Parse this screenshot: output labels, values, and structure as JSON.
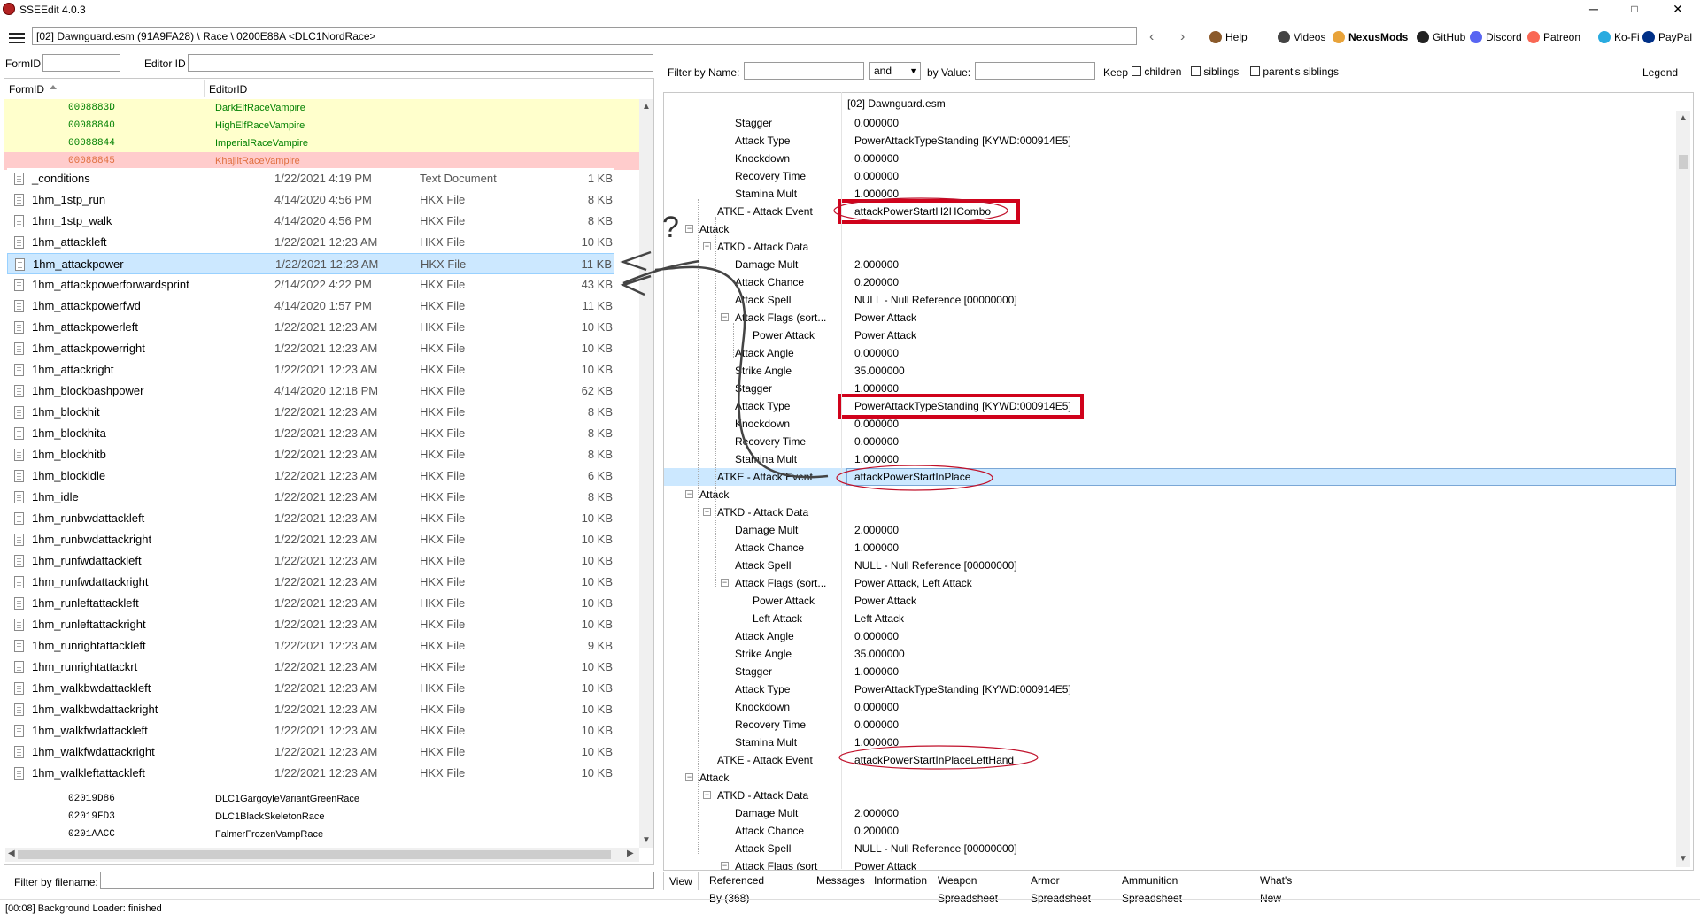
{
  "window": {
    "title": "SSEEdit 4.0.3",
    "minimize": "─",
    "maximize": "□",
    "close": "✕"
  },
  "toolbar": {
    "path": "[02] Dawnguard.esm (91A9FA28) \\ Race \\ 0200E88A <DLC1NordRace>",
    "back": "‹",
    "forward": "›",
    "links": [
      {
        "label": "Help",
        "icon": "book-icon",
        "color": "#8b5a2b"
      },
      {
        "label": "Videos",
        "icon": "video-icon",
        "color": "#444444"
      },
      {
        "label": "NexusMods",
        "icon": "nexusmods-icon",
        "color": "#e8a33a"
      },
      {
        "label": "GitHub",
        "icon": "github-icon",
        "color": "#222222"
      },
      {
        "label": "Discord",
        "icon": "discord-icon",
        "color": "#5865f2"
      },
      {
        "label": "Patreon",
        "icon": "patreon-icon",
        "color": "#f96854"
      },
      {
        "label": "Ko-Fi",
        "icon": "kofi-icon",
        "color": "#29abe0"
      },
      {
        "label": "PayPal",
        "icon": "paypal-icon",
        "color": "#003087"
      }
    ]
  },
  "left_filter": {
    "formid_label": "FormID",
    "editorid_label": "Editor ID"
  },
  "left_tree": {
    "col_formid": "FormID",
    "col_editorid": "EditorID",
    "top_rows": [
      {
        "fid": "0008883D",
        "eid": "DarkElfRaceVampire",
        "bg": "#ffffcc",
        "color": "#008000"
      },
      {
        "fid": "00088840",
        "eid": "HighElfRaceVampire",
        "bg": "#ffffcc",
        "color": "#008000"
      },
      {
        "fid": "00088844",
        "eid": "ImperialRaceVampire",
        "bg": "#ffffcc",
        "color": "#008000"
      },
      {
        "fid": "00088845",
        "eid": "KhajiitRaceVampire",
        "bg": "#ffcccc",
        "color": "#e07040"
      }
    ],
    "bottom_rows": [
      {
        "fid": "02019D86",
        "eid": "DLC1GargoyleVariantGreenRace"
      },
      {
        "fid": "02019FD3",
        "eid": "DLC1BlackSkeletonRace"
      },
      {
        "fid": "0201AACC",
        "eid": "FalmerFrozenVampRace"
      }
    ],
    "filter_label": "Filter by filename:"
  },
  "explorer": {
    "files": [
      {
        "name": "_conditions",
        "date": "1/22/2021 4:19 PM",
        "type": "Text Document",
        "size": "1 KB"
      },
      {
        "name": "1hm_1stp_run",
        "date": "4/14/2020 4:56 PM",
        "type": "HKX File",
        "size": "8 KB"
      },
      {
        "name": "1hm_1stp_walk",
        "date": "4/14/2020 4:56 PM",
        "type": "HKX File",
        "size": "8 KB"
      },
      {
        "name": "1hm_attackleft",
        "date": "1/22/2021 12:23 AM",
        "type": "HKX File",
        "size": "10 KB"
      },
      {
        "name": "1hm_attackpower",
        "date": "1/22/2021 12:23 AM",
        "type": "HKX File",
        "size": "11 KB"
      },
      {
        "name": "1hm_attackpowerforwardsprint",
        "date": "2/14/2022 4:22 PM",
        "type": "HKX File",
        "size": "43 KB"
      },
      {
        "name": "1hm_attackpowerfwd",
        "date": "4/14/2020 1:57 PM",
        "type": "HKX File",
        "size": "11 KB"
      },
      {
        "name": "1hm_attackpowerleft",
        "date": "1/22/2021 12:23 AM",
        "type": "HKX File",
        "size": "10 KB"
      },
      {
        "name": "1hm_attackpowerright",
        "date": "1/22/2021 12:23 AM",
        "type": "HKX File",
        "size": "10 KB"
      },
      {
        "name": "1hm_attackright",
        "date": "1/22/2021 12:23 AM",
        "type": "HKX File",
        "size": "10 KB"
      },
      {
        "name": "1hm_blockbashpower",
        "date": "4/14/2020 12:18 PM",
        "type": "HKX File",
        "size": "62 KB"
      },
      {
        "name": "1hm_blockhit",
        "date": "1/22/2021 12:23 AM",
        "type": "HKX File",
        "size": "8 KB"
      },
      {
        "name": "1hm_blockhita",
        "date": "1/22/2021 12:23 AM",
        "type": "HKX File",
        "size": "8 KB"
      },
      {
        "name": "1hm_blockhitb",
        "date": "1/22/2021 12:23 AM",
        "type": "HKX File",
        "size": "8 KB"
      },
      {
        "name": "1hm_blockidle",
        "date": "1/22/2021 12:23 AM",
        "type": "HKX File",
        "size": "6 KB"
      },
      {
        "name": "1hm_idle",
        "date": "1/22/2021 12:23 AM",
        "type": "HKX File",
        "size": "8 KB"
      },
      {
        "name": "1hm_runbwdattackleft",
        "date": "1/22/2021 12:23 AM",
        "type": "HKX File",
        "size": "10 KB"
      },
      {
        "name": "1hm_runbwdattackright",
        "date": "1/22/2021 12:23 AM",
        "type": "HKX File",
        "size": "10 KB"
      },
      {
        "name": "1hm_runfwdattackleft",
        "date": "1/22/2021 12:23 AM",
        "type": "HKX File",
        "size": "10 KB"
      },
      {
        "name": "1hm_runfwdattackright",
        "date": "1/22/2021 12:23 AM",
        "type": "HKX File",
        "size": "10 KB"
      },
      {
        "name": "1hm_runleftattackleft",
        "date": "1/22/2021 12:23 AM",
        "type": "HKX File",
        "size": "10 KB"
      },
      {
        "name": "1hm_runleftattackright",
        "date": "1/22/2021 12:23 AM",
        "type": "HKX File",
        "size": "10 KB"
      },
      {
        "name": "1hm_runrightattackleft",
        "date": "1/22/2021 12:23 AM",
        "type": "HKX File",
        "size": "9 KB"
      },
      {
        "name": "1hm_runrightattackrt",
        "date": "1/22/2021 12:23 AM",
        "type": "HKX File",
        "size": "10 KB"
      },
      {
        "name": "1hm_walkbwdattackleft",
        "date": "1/22/2021 12:23 AM",
        "type": "HKX File",
        "size": "10 KB"
      },
      {
        "name": "1hm_walkbwdattackright",
        "date": "1/22/2021 12:23 AM",
        "type": "HKX File",
        "size": "10 KB"
      },
      {
        "name": "1hm_walkfwdattackleft",
        "date": "1/22/2021 12:23 AM",
        "type": "HKX File",
        "size": "10 KB"
      },
      {
        "name": "1hm_walkfwdattackright",
        "date": "1/22/2021 12:23 AM",
        "type": "HKX File",
        "size": "10 KB"
      },
      {
        "name": "1hm_walkleftattackleft",
        "date": "1/22/2021 12:23 AM",
        "type": "HKX File",
        "size": "10 KB"
      }
    ],
    "selected_name": "1hm_attackpower"
  },
  "annotation": {
    "question_mark": "?"
  },
  "right_filter": {
    "by_name_label": "Filter by Name:",
    "op_value": "and",
    "by_value_label": "by Value:",
    "keep_label": "Keep",
    "children_label": "children",
    "siblings_label": "siblings",
    "parents_siblings_label": "parent's siblings",
    "legend_label": "Legend"
  },
  "record_view": {
    "column_header": "[02] Dawnguard.esm",
    "rows": [
      {
        "name": "Stagger",
        "value": "0.000000",
        "indent": 3
      },
      {
        "name": "Attack Type",
        "value": "PowerAttackTypeStanding [KYWD:000914E5]",
        "indent": 3
      },
      {
        "name": "Knockdown",
        "value": "0.000000",
        "indent": 3
      },
      {
        "name": "Recovery Time",
        "value": "0.000000",
        "indent": 3
      },
      {
        "name": "Stamina Mult",
        "value": "1.000000",
        "indent": 3
      },
      {
        "name": "ATKE - Attack Event",
        "value": "attackPowerStartH2HCombo",
        "indent": 2,
        "highlight": true
      },
      {
        "name": "Attack",
        "value": "",
        "indent": 1,
        "expander": true
      },
      {
        "name": "ATKD - Attack Data",
        "value": "",
        "indent": 2,
        "expander": true
      },
      {
        "name": "Damage Mult",
        "value": "2.000000",
        "indent": 3
      },
      {
        "name": "Attack Chance",
        "value": "0.200000",
        "indent": 3
      },
      {
        "name": "Attack Spell",
        "value": "NULL - Null Reference [00000000]",
        "indent": 3
      },
      {
        "name": "Attack Flags (sort...",
        "value": "Power Attack",
        "indent": 3,
        "expander": true
      },
      {
        "name": "Power Attack",
        "value": "Power Attack",
        "indent": 4
      },
      {
        "name": "Attack Angle",
        "value": "0.000000",
        "indent": 3
      },
      {
        "name": "Strike Angle",
        "value": "35.000000",
        "indent": 3
      },
      {
        "name": "Stagger",
        "value": "1.000000",
        "indent": 3
      },
      {
        "name": "Attack Type",
        "value": "PowerAttackTypeStanding [KYWD:000914E5]",
        "indent": 3,
        "highlight": true
      },
      {
        "name": "Knockdown",
        "value": "0.000000",
        "indent": 3
      },
      {
        "name": "Recovery Time",
        "value": "0.000000",
        "indent": 3
      },
      {
        "name": "Stamina Mult",
        "value": "1.000000",
        "indent": 3
      },
      {
        "name": "ATKE - Attack Event",
        "value": "attackPowerStartInPlace",
        "indent": 2,
        "selected": true
      },
      {
        "name": "Attack",
        "value": "",
        "indent": 1,
        "expander": true
      },
      {
        "name": "ATKD - Attack Data",
        "value": "",
        "indent": 2,
        "expander": true
      },
      {
        "name": "Damage Mult",
        "value": "2.000000",
        "indent": 3
      },
      {
        "name": "Attack Chance",
        "value": "1.000000",
        "indent": 3
      },
      {
        "name": "Attack Spell",
        "value": "NULL - Null Reference [00000000]",
        "indent": 3
      },
      {
        "name": "Attack Flags (sort...",
        "value": "Power Attack, Left Attack",
        "indent": 3,
        "expander": true
      },
      {
        "name": "Power Attack",
        "value": "Power Attack",
        "indent": 4
      },
      {
        "name": "Left Attack",
        "value": "Left Attack",
        "indent": 4
      },
      {
        "name": "Attack Angle",
        "value": "0.000000",
        "indent": 3
      },
      {
        "name": "Strike Angle",
        "value": "35.000000",
        "indent": 3
      },
      {
        "name": "Stagger",
        "value": "1.000000",
        "indent": 3
      },
      {
        "name": "Attack Type",
        "value": "PowerAttackTypeStanding [KYWD:000914E5]",
        "indent": 3
      },
      {
        "name": "Knockdown",
        "value": "0.000000",
        "indent": 3
      },
      {
        "name": "Recovery Time",
        "value": "0.000000",
        "indent": 3
      },
      {
        "name": "Stamina Mult",
        "value": "1.000000",
        "indent": 3
      },
      {
        "name": "ATKE - Attack Event",
        "value": "attackPowerStartInPlaceLeftHand",
        "indent": 2
      },
      {
        "name": "Attack",
        "value": "",
        "indent": 1,
        "expander": true
      },
      {
        "name": "ATKD - Attack Data",
        "value": "",
        "indent": 2,
        "expander": true
      },
      {
        "name": "Damage Mult",
        "value": "2.000000",
        "indent": 3
      },
      {
        "name": "Attack Chance",
        "value": "0.200000",
        "indent": 3
      },
      {
        "name": "Attack Spell",
        "value": "NULL - Null Reference [00000000]",
        "indent": 3
      },
      {
        "name": "Attack Flags (sort",
        "value": "Power Attack",
        "indent": 3,
        "expander": true
      }
    ]
  },
  "tabs": [
    "View",
    "Referenced By (368)",
    "Messages",
    "Information",
    "Weapon Spreadsheet",
    "Armor Spreadsheet",
    "Ammunition Spreadsheet",
    "What's New"
  ],
  "status": {
    "text": "[00:08] Background Loader: finished"
  }
}
